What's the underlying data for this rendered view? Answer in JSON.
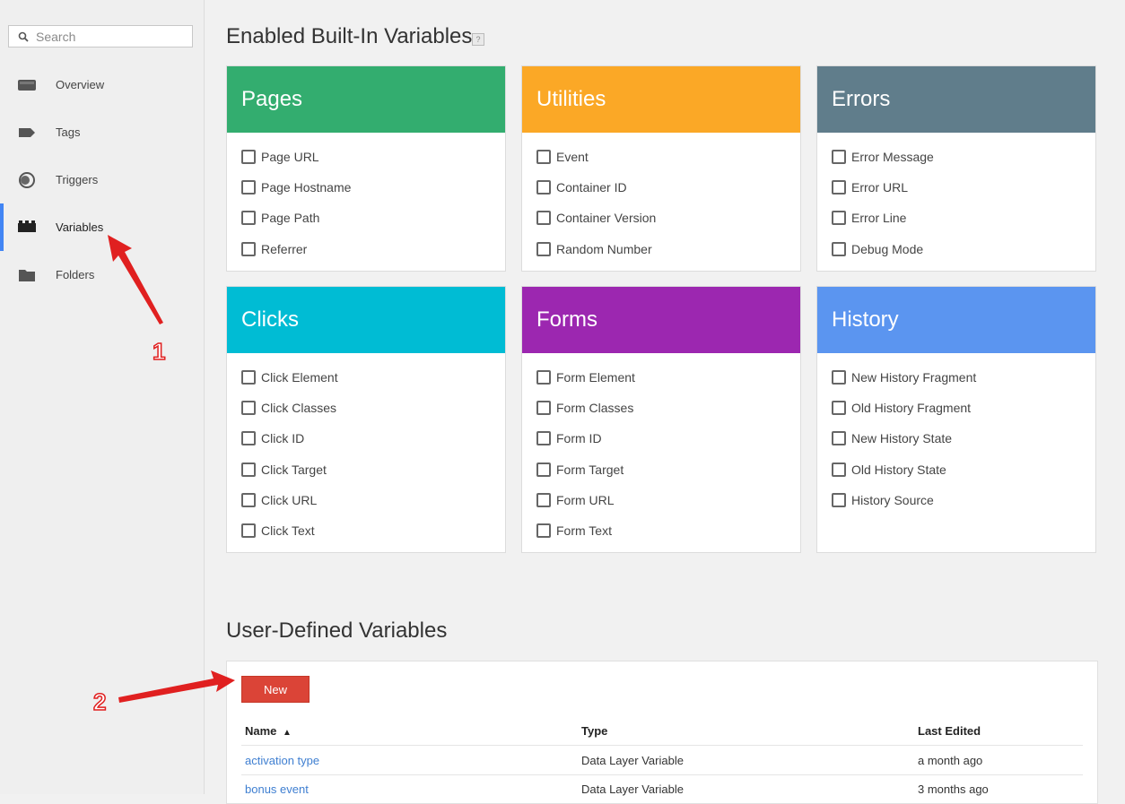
{
  "sidebar": {
    "search_placeholder": "Search",
    "items": [
      {
        "label": "Overview",
        "icon": "overview-icon"
      },
      {
        "label": "Tags",
        "icon": "tag-icon"
      },
      {
        "label": "Triggers",
        "icon": "triggers-icon"
      },
      {
        "label": "Variables",
        "icon": "variables-icon",
        "active": true
      },
      {
        "label": "Folders",
        "icon": "folder-icon"
      }
    ]
  },
  "builtin": {
    "title": "Enabled Built-In Variables",
    "help": "?",
    "cards": [
      {
        "title": "Pages",
        "color": "#33ad6f",
        "items": [
          "Page URL",
          "Page Hostname",
          "Page Path",
          "Referrer"
        ]
      },
      {
        "title": "Utilities",
        "color": "#fba826",
        "items": [
          "Event",
          "Container ID",
          "Container Version",
          "Random Number"
        ]
      },
      {
        "title": "Errors",
        "color": "#607d8b",
        "items": [
          "Error Message",
          "Error URL",
          "Error Line",
          "Debug Mode"
        ]
      },
      {
        "title": "Clicks",
        "color": "#00bcd4",
        "items": [
          "Click Element",
          "Click Classes",
          "Click ID",
          "Click Target",
          "Click URL",
          "Click Text"
        ]
      },
      {
        "title": "Forms",
        "color": "#9c27b0",
        "items": [
          "Form Element",
          "Form Classes",
          "Form ID",
          "Form Target",
          "Form URL",
          "Form Text"
        ]
      },
      {
        "title": "History",
        "color": "#5b95f0",
        "items": [
          "New History Fragment",
          "Old History Fragment",
          "New History State",
          "Old History State",
          "History Source"
        ]
      }
    ]
  },
  "user_defined": {
    "title": "User-Defined Variables",
    "new_label": "New",
    "columns": {
      "name": "Name",
      "sort_indicator": "▲",
      "type": "Type",
      "last_edited": "Last Edited"
    },
    "rows": [
      {
        "name": "activation type",
        "type": "Data Layer Variable",
        "last_edited": "a month ago"
      },
      {
        "name": "bonus event",
        "type": "Data Layer Variable",
        "last_edited": "3 months ago"
      }
    ]
  },
  "annotations": {
    "one": "1",
    "two": "2",
    "color": "#e02020"
  }
}
